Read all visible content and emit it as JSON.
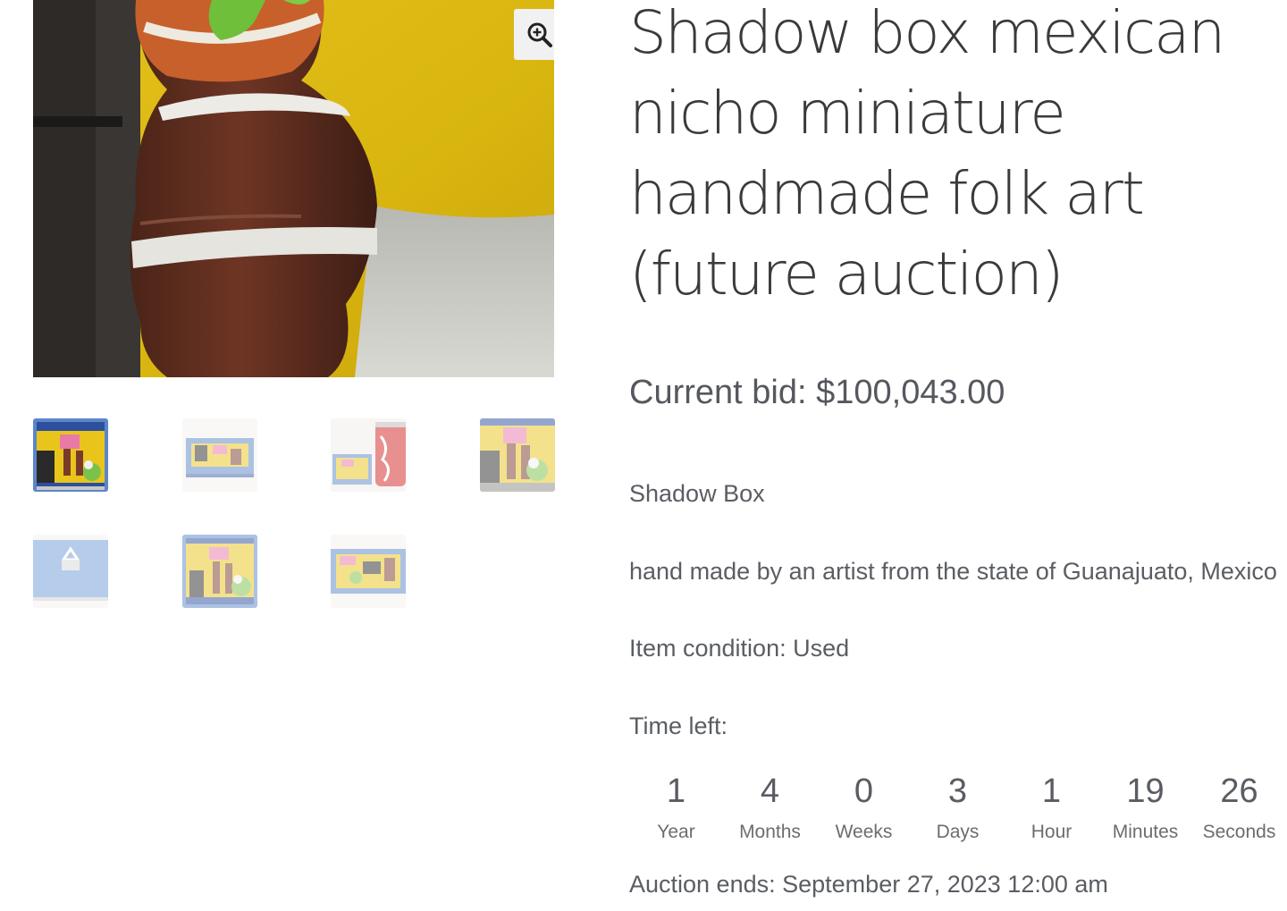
{
  "gallery": {
    "main_image_alt": "",
    "zoom_icon": "zoom-in-icon",
    "thumbnails": [
      {
        "name": "thumb-1",
        "active": true
      },
      {
        "name": "thumb-2",
        "active": false
      },
      {
        "name": "thumb-3",
        "active": false
      },
      {
        "name": "thumb-4",
        "active": false
      },
      {
        "name": "thumb-5",
        "active": false
      },
      {
        "name": "thumb-6",
        "active": false
      },
      {
        "name": "thumb-7",
        "active": false
      }
    ]
  },
  "product": {
    "title": "Shadow box mexican nicho miniature handmade folk art (future auction)",
    "current_bid_label": "Current bid:",
    "current_bid_value": "$100,043.00",
    "description": [
      "Shadow Box",
      "hand made by an artist from the state of Guanajuato, Mexico",
      "Item condition: Used"
    ],
    "time_left_label": "Time left:",
    "countdown": [
      {
        "amount": "1",
        "period": "Year"
      },
      {
        "amount": "4",
        "period": "Months"
      },
      {
        "amount": "0",
        "period": "Weeks"
      },
      {
        "amount": "3",
        "period": "Days"
      },
      {
        "amount": "1",
        "period": "Hour"
      },
      {
        "amount": "19",
        "period": "Minutes"
      },
      {
        "amount": "26",
        "period": "Seconds"
      }
    ],
    "auction_ends_label": "Auction ends:",
    "auction_ends_value": "September 27, 2023 12:00 am"
  },
  "colors": {
    "text": "#404040",
    "muted": "#5a5d63",
    "zoom_bg": "#f1f1f1",
    "photo_yellow": "#d9b515",
    "box_blue": "#6f9ad9"
  }
}
